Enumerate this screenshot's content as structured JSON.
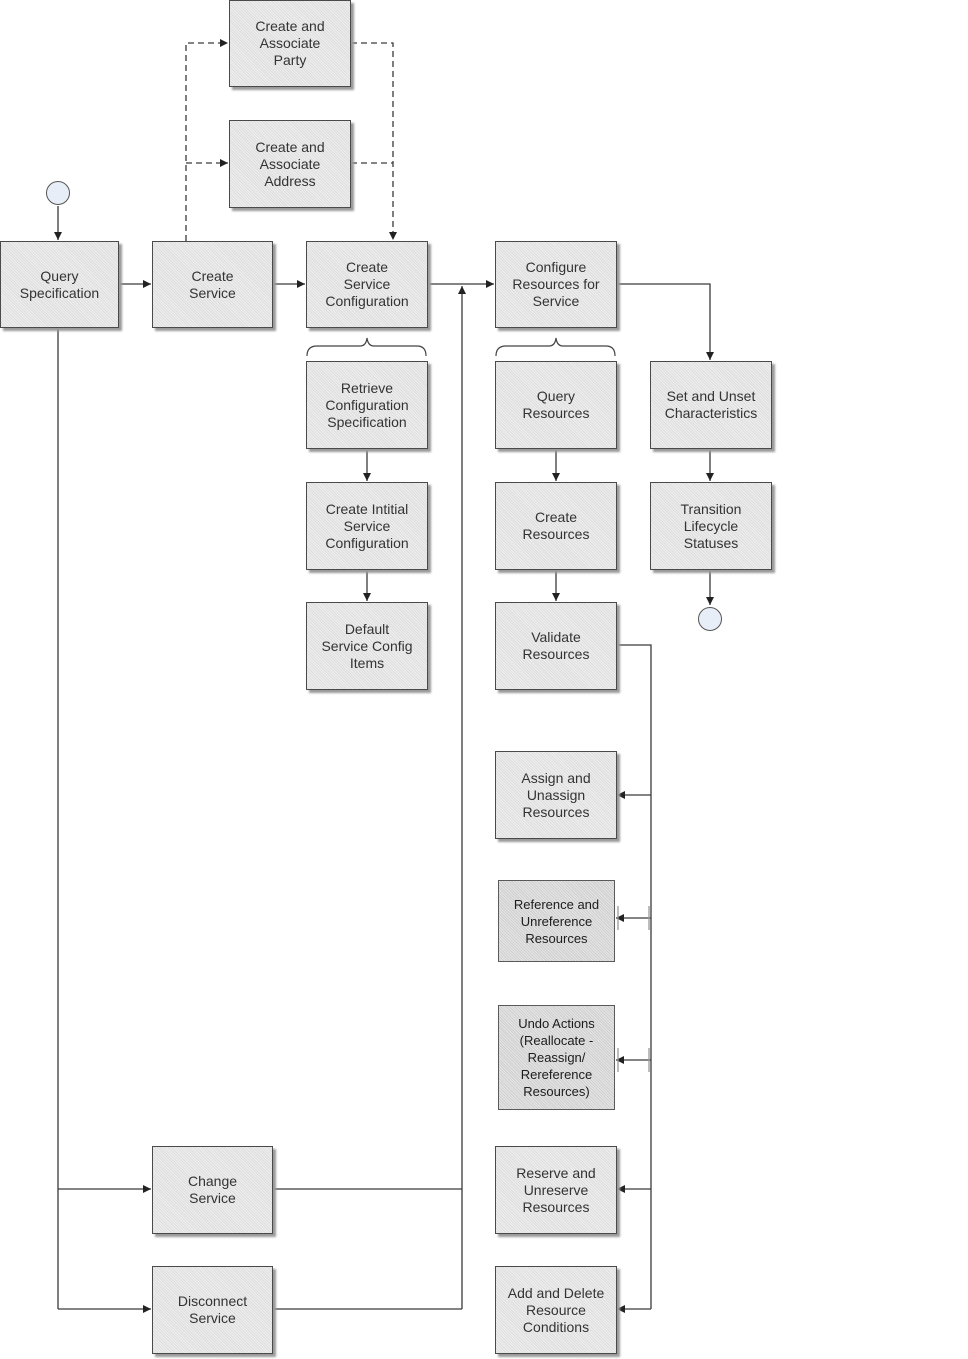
{
  "diagram": {
    "type": "process-flow",
    "colors": {
      "box_fill": "#e6e6e6",
      "box_fill_alt": "#d7d7d7",
      "box_border": "#4a4a4a",
      "line": "#333333",
      "event_fill": "#e8eef8"
    },
    "events": [
      {
        "id": "start",
        "kind": "start-event"
      },
      {
        "id": "end",
        "kind": "end-event"
      }
    ],
    "nodes": [
      {
        "id": "query-specification",
        "label": "Query\nSpecification"
      },
      {
        "id": "create-service",
        "label": "Create\nService"
      },
      {
        "id": "create-associate-party",
        "label": "Create and\nAssociate\nParty"
      },
      {
        "id": "create-associate-address",
        "label": "Create and\nAssociate\nAddress"
      },
      {
        "id": "create-service-configuration",
        "label": "Create\nService\nConfiguration"
      },
      {
        "id": "retrieve-configuration-specification",
        "label": "Retrieve\nConfiguration\nSpecification"
      },
      {
        "id": "create-initial-service-configuration",
        "label": "Create Intitial\nService\nConfiguration"
      },
      {
        "id": "default-service-config-items",
        "label": "Default\nService Config\nItems"
      },
      {
        "id": "configure-resources-for-service",
        "label": "Configure\nResources for\nService"
      },
      {
        "id": "query-resources",
        "label": "Query\nResources"
      },
      {
        "id": "create-resources",
        "label": "Create\nResources"
      },
      {
        "id": "validate-resources",
        "label": "Validate\nResources"
      },
      {
        "id": "assign-unassign-resources",
        "label": "Assign and\nUnassign\nResources"
      },
      {
        "id": "reference-unreference-resources",
        "label": "Reference and\nUnreference\nResources"
      },
      {
        "id": "undo-actions",
        "label": "Undo Actions\n(Reallocate -\nReassign/\nRereference\nResources)"
      },
      {
        "id": "reserve-unreserve-resources",
        "label": "Reserve and\nUnreserve\nResources"
      },
      {
        "id": "add-delete-resource-conditions",
        "label": "Add and Delete\nResource\nConditions"
      },
      {
        "id": "set-unset-characteristics",
        "label": "Set and Unset\nCharacteristics"
      },
      {
        "id": "transition-lifecycle-statuses",
        "label": "Transition\nLifecycle\nStatuses"
      },
      {
        "id": "change-service",
        "label": "Change\nService"
      },
      {
        "id": "disconnect-service",
        "label": "Disconnect\nService"
      }
    ],
    "edges": [
      {
        "from": "start",
        "to": "query-specification",
        "style": "solid"
      },
      {
        "from": "query-specification",
        "to": "create-service",
        "style": "solid"
      },
      {
        "from": "query-specification",
        "to": "change-service",
        "style": "solid"
      },
      {
        "from": "query-specification",
        "to": "disconnect-service",
        "style": "solid"
      },
      {
        "from": "create-service",
        "to": "create-service-configuration",
        "style": "solid"
      },
      {
        "from": "create-service",
        "to": "create-associate-party",
        "style": "dashed"
      },
      {
        "from": "create-service",
        "to": "create-associate-address",
        "style": "dashed"
      },
      {
        "from": "create-associate-party",
        "to": "create-service-configuration",
        "style": "dashed"
      },
      {
        "from": "create-associate-address",
        "to": "create-service-configuration",
        "style": "dashed"
      },
      {
        "from": "create-service-configuration",
        "to": "configure-resources-for-service",
        "style": "solid"
      },
      {
        "from": "change-service",
        "to": "configure-resources-for-service",
        "style": "solid"
      },
      {
        "from": "disconnect-service",
        "to": "configure-resources-for-service",
        "style": "solid"
      },
      {
        "from": "retrieve-configuration-specification",
        "to": "create-initial-service-configuration",
        "style": "solid"
      },
      {
        "from": "create-initial-service-configuration",
        "to": "default-service-config-items",
        "style": "solid"
      },
      {
        "from": "configure-resources-for-service",
        "to": "set-unset-characteristics",
        "style": "solid"
      },
      {
        "from": "query-resources",
        "to": "create-resources",
        "style": "solid"
      },
      {
        "from": "create-resources",
        "to": "validate-resources",
        "style": "solid"
      },
      {
        "from": "validate-resources",
        "to": "assign-unassign-resources",
        "style": "solid"
      },
      {
        "from": "validate-resources",
        "to": "reference-unreference-resources",
        "style": "solid"
      },
      {
        "from": "validate-resources",
        "to": "undo-actions",
        "style": "solid"
      },
      {
        "from": "validate-resources",
        "to": "reserve-unreserve-resources",
        "style": "solid"
      },
      {
        "from": "validate-resources",
        "to": "add-delete-resource-conditions",
        "style": "solid"
      },
      {
        "from": "set-unset-characteristics",
        "to": "transition-lifecycle-statuses",
        "style": "solid"
      },
      {
        "from": "transition-lifecycle-statuses",
        "to": "end",
        "style": "solid"
      }
    ],
    "groupings": [
      {
        "parent": "create-service-configuration",
        "children": [
          "retrieve-configuration-specification",
          "create-initial-service-configuration",
          "default-service-config-items"
        ]
      },
      {
        "parent": "configure-resources-for-service",
        "children": [
          "query-resources",
          "create-resources",
          "validate-resources"
        ]
      }
    ]
  }
}
